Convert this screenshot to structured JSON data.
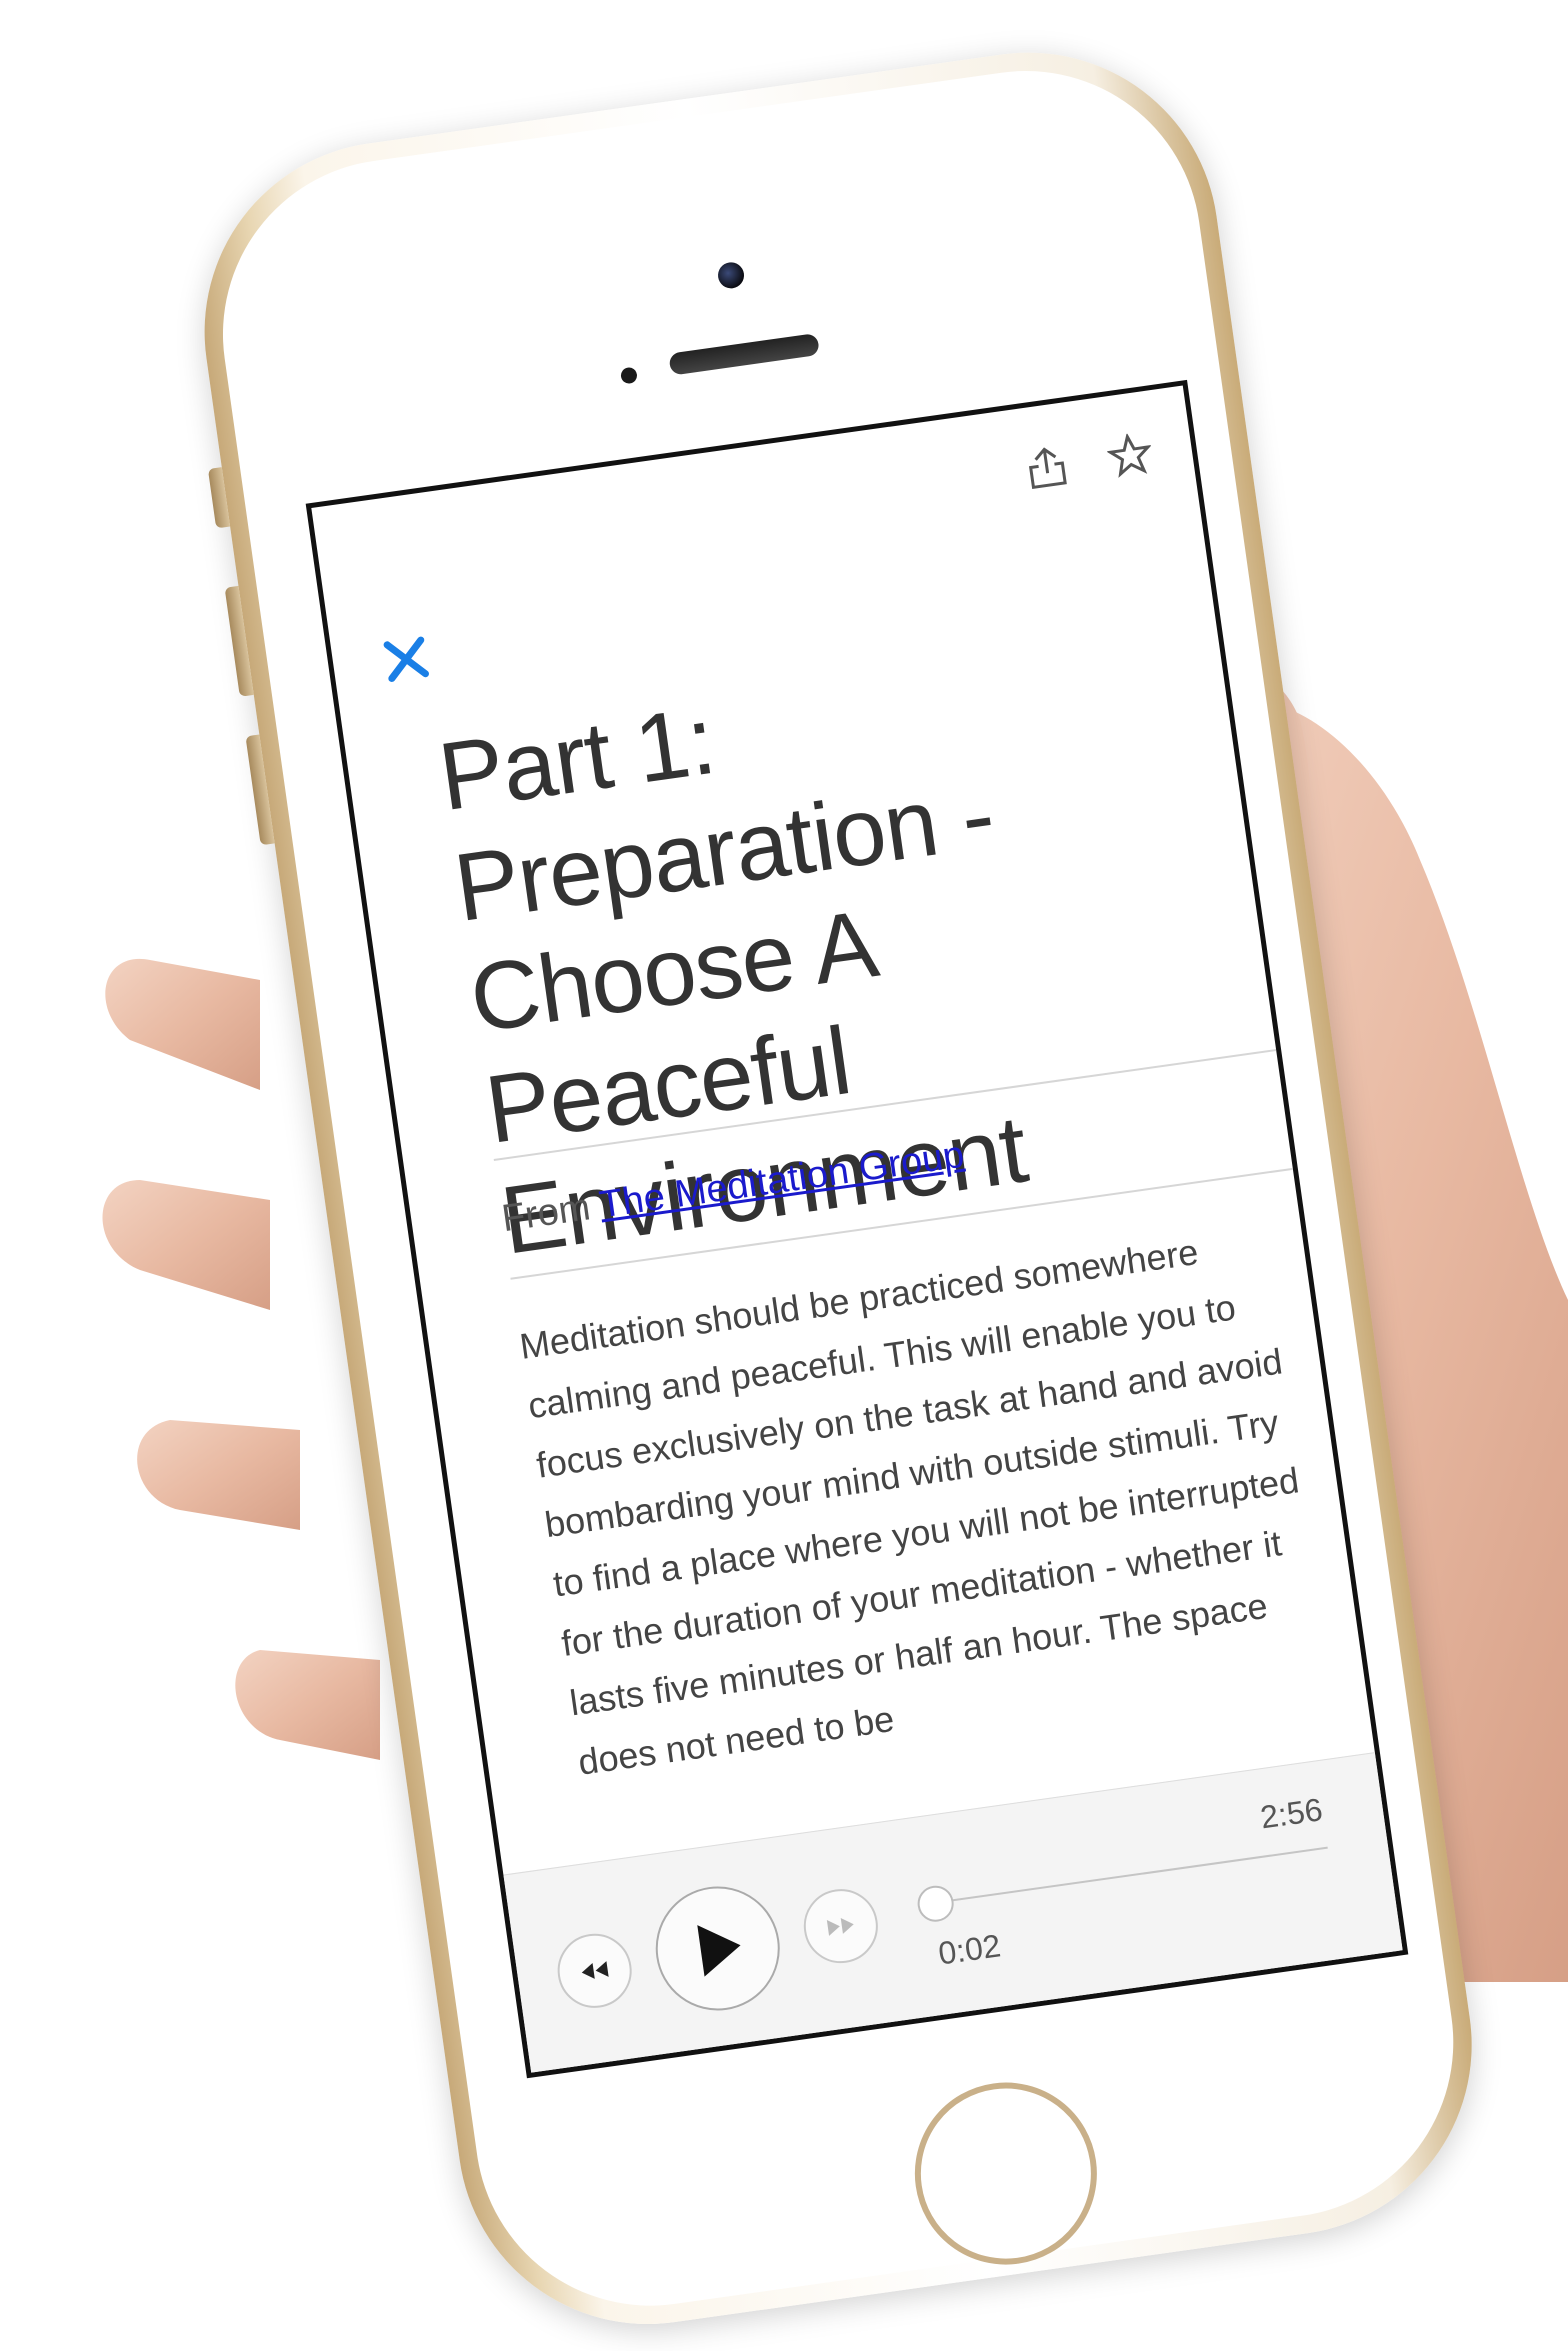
{
  "toolbar": {
    "share_icon": "share-icon",
    "favorite_icon": "star-icon",
    "close_icon": "close-icon"
  },
  "article": {
    "title": "Part 1: Preparation - Choose A Peaceful Environment",
    "from_label": "From",
    "source_name": "The Meditation Group",
    "body": "Meditation should be practiced somewhere calming and peaceful. This will enable you to focus exclusively on the task at hand and avoid bombarding your mind with outside stimuli. Try to find a place where you will not be interrupted for the duration of your meditation - whether it lasts five minutes or half an hour. The space does not need to be"
  },
  "player": {
    "rewind_icon": "rewind-icon",
    "play_icon": "play-icon",
    "fast_forward_icon": "fast-forward-icon",
    "current_time": "0:02",
    "total_time": "2:56",
    "progress": 0.011
  },
  "colors": {
    "accent": "#1a7fe6",
    "link": "#1a1acc",
    "phone_gold": "#d4b98c",
    "bezel": "#111111"
  }
}
